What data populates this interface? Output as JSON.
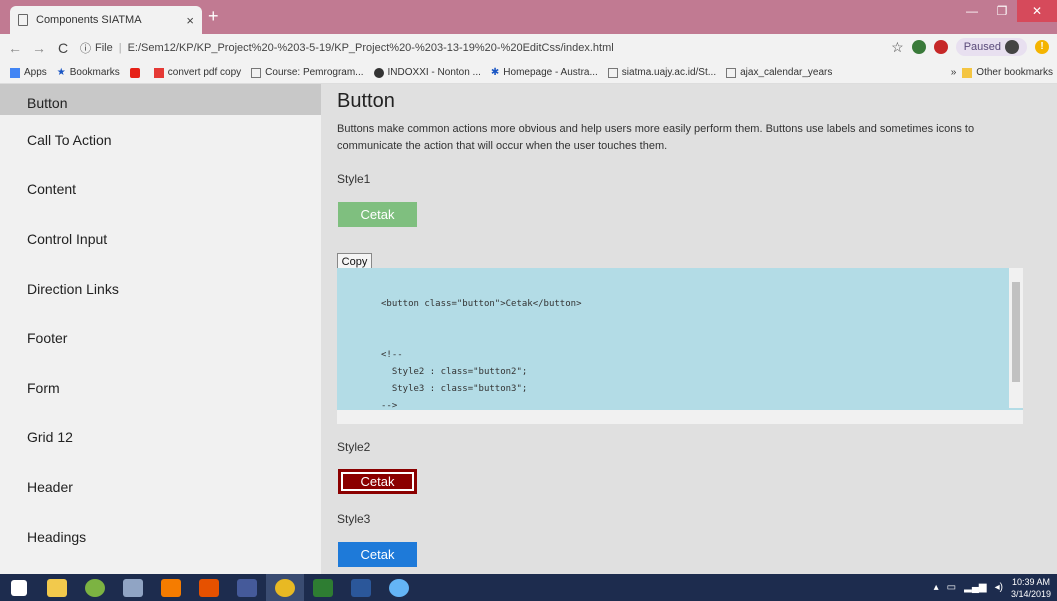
{
  "browser": {
    "tab_title": "Components SIATMA",
    "tab_close": "×",
    "new_tab": "+",
    "info_label": "ⓘ",
    "file_label": "File",
    "url": "E:/Sem12/KP/KP_Project%20-%203-5-19/KP_Project%20-%203-13-19%20-%20EditCss/index.html",
    "paused_label": "Paused",
    "bookmarks": [
      {
        "label": "Apps"
      },
      {
        "label": "Bookmarks"
      },
      {
        "label": ""
      },
      {
        "label": "convert pdf copy"
      },
      {
        "label": "Course: Pemrogram..."
      },
      {
        "label": "INDOXXI - Nonton ..."
      },
      {
        "label": "Homepage - Austra..."
      },
      {
        "label": "siatma.uajy.ac.id/St..."
      },
      {
        "label": "ajax_calendar_years"
      }
    ],
    "more_label": "»",
    "other_bookmarks": "Other bookmarks"
  },
  "sidebar": {
    "items": [
      {
        "label": "Button"
      },
      {
        "label": "Call To Action"
      },
      {
        "label": "Content"
      },
      {
        "label": "Control Input"
      },
      {
        "label": "Direction Links"
      },
      {
        "label": "Footer"
      },
      {
        "label": "Form"
      },
      {
        "label": "Grid 12"
      },
      {
        "label": "Header"
      },
      {
        "label": "Headings"
      }
    ]
  },
  "main": {
    "title": "Button",
    "description": "Buttons make common actions more obvious and help users more easily perform them. Buttons use labels and sometimes icons to communicate the action that will occur when the user touches them.",
    "style1_label": "Style1",
    "style2_label": "Style2",
    "style3_label": "Style3",
    "button_label": "Cetak",
    "copy_label": "Copy",
    "code": "<button class=\"button\">Cetak</button>\n\n\n<!--\n  Style2 : class=\"button2\";\n  Style3 : class=\"button3\";\n-->"
  },
  "taskbar": {
    "time": "10:39 AM",
    "date": "3/14/2019"
  }
}
